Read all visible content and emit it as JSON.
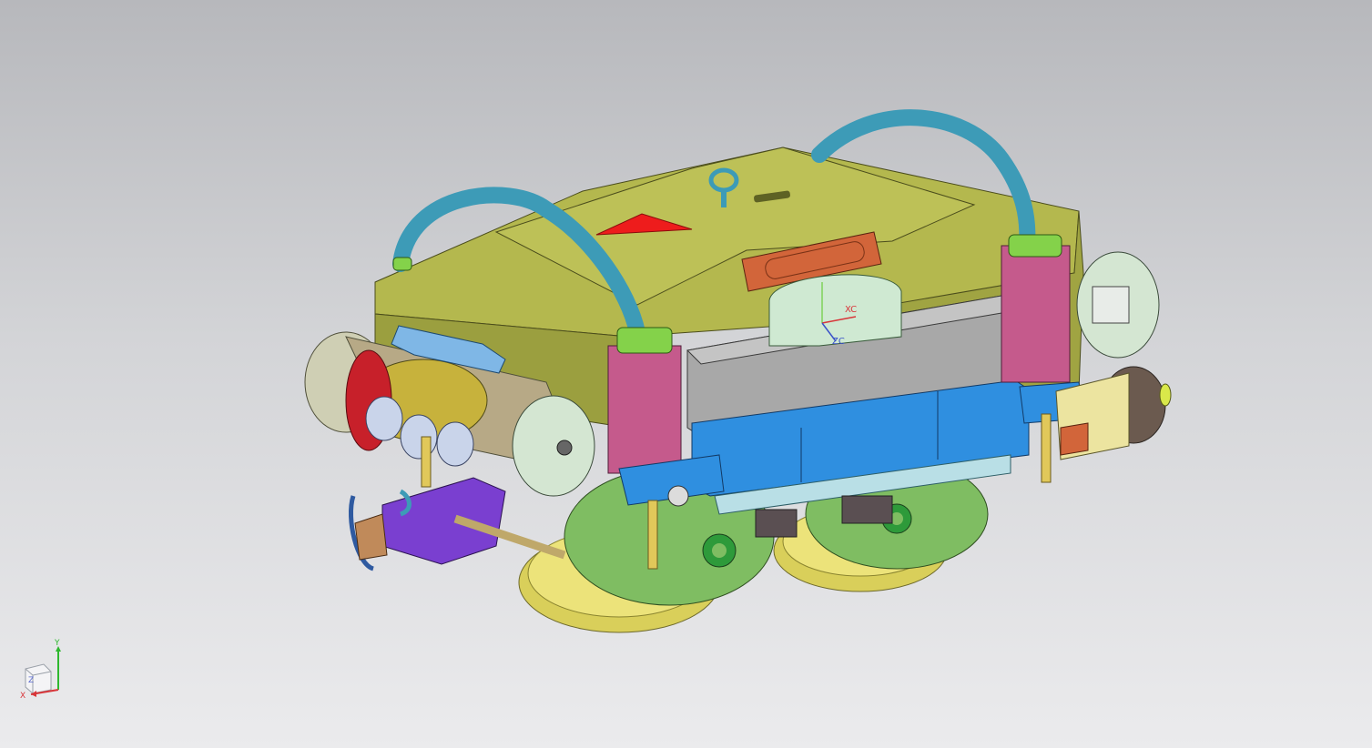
{
  "viewport": {
    "background_top": "#b7b8bc",
    "background_bottom": "#ebebed"
  },
  "wcs": {
    "x_label": "XC",
    "z_label": "ZC",
    "x_color": "#d8363a",
    "z_color": "#3a52c9"
  },
  "triad": {
    "x_label": "X",
    "y_label": "Y",
    "z_label": "Z"
  },
  "model": {
    "body_color": "#a9ad47",
    "handle_color": "#3d9bb7",
    "bracket_color": "#c55a8c",
    "side_plate_color": "#2f8fe0",
    "cover_color": "#a8a8a8",
    "wheel_color": "#d9cf5a",
    "motor_color": "#7fbd62",
    "clamp_color": "#7a3fd0",
    "connector_color": "#d2653a",
    "nozzle_color": "#c8b04a"
  }
}
